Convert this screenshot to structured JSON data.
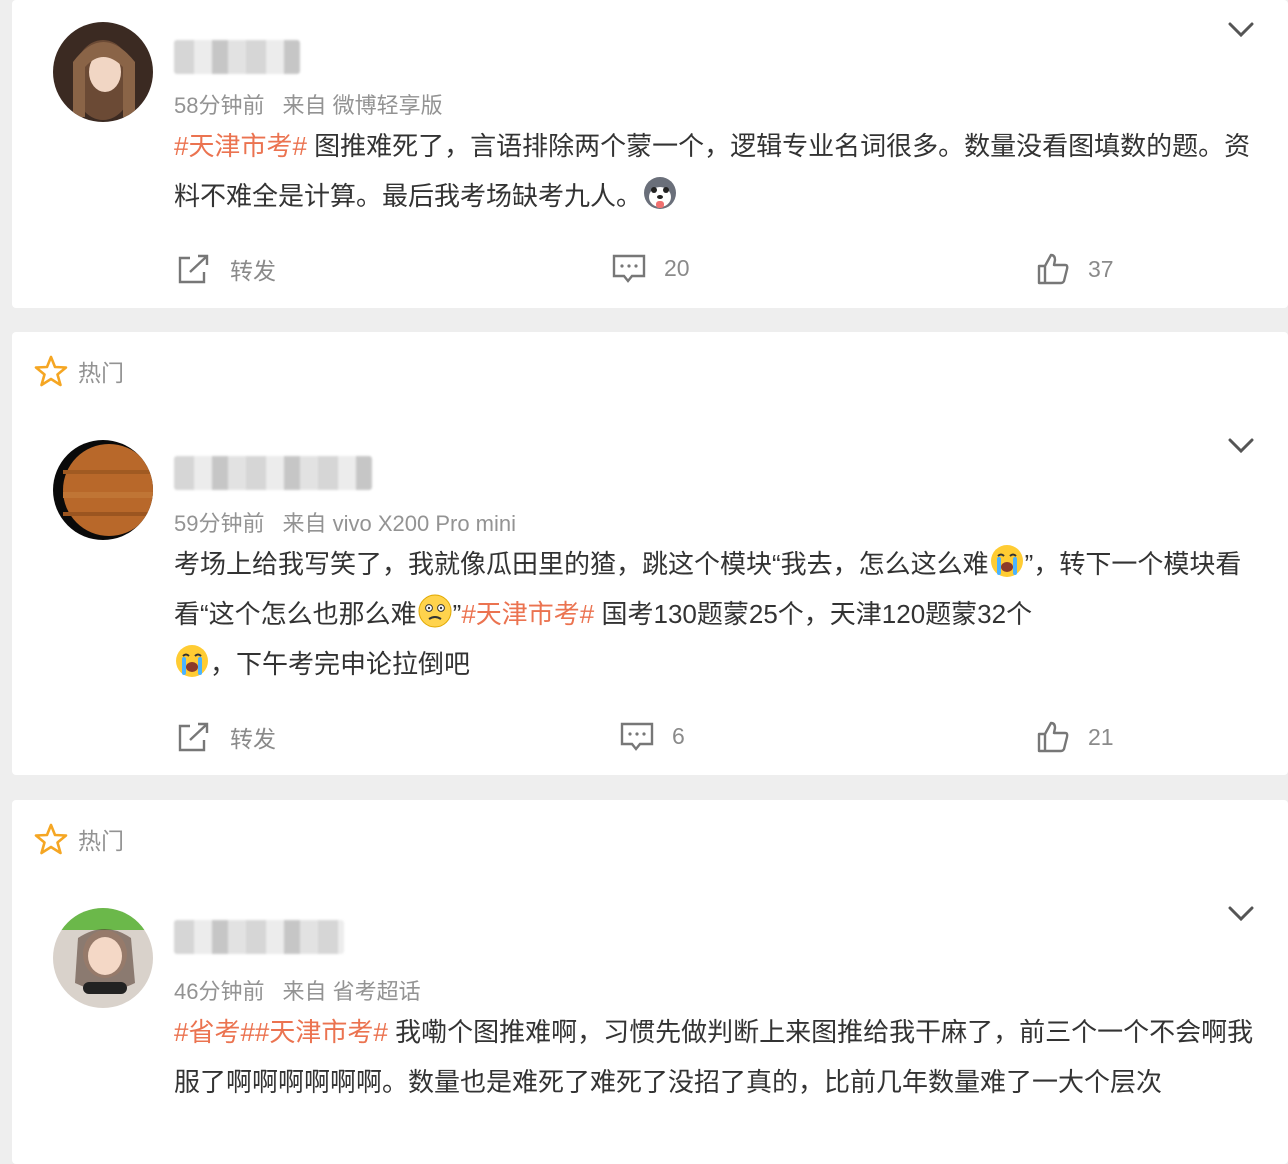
{
  "posts": [
    {
      "hot_label": "",
      "time": "58分钟前",
      "source": "来自 微博轻享版",
      "tags_prefix": "#天津市考#",
      "text_a": " 图推难死了，言语排除两个蒙一个，逻辑专业名词很多。数量没看图填数的题。资料不难全是计算。最后我考场缺考九人。",
      "repost_label": "转发",
      "comments": "20",
      "likes": "37"
    },
    {
      "hot_label": "热门",
      "time": "59分钟前",
      "source": "来自 vivo X200 Pro mini",
      "text_a": "考场上给我写笑了，我就像瓜田里的猹，跳这个模块“我去，怎么这么难",
      "text_b": "”，转下一个模块看看“这个怎么也那么难",
      "text_c": "”",
      "tag": "#天津市考#",
      "text_d": " 国考130题蒙25个，天津120题蒙32个",
      "text_e": "，下午考完申论拉倒吧",
      "repost_label": "转发",
      "comments": "6",
      "likes": "21"
    },
    {
      "hot_label": "热门",
      "time": "46分钟前",
      "source": "来自 省考超话",
      "tags_prefix": "#省考##天津市考#",
      "text_a": " 我嘞个图推难啊，习惯先做判断上来图推给我干麻了，前三个一个不会啊我服了啊啊啊啊啊啊。数量也是难死了难死了没招了真的，比前几年数量难了一大个层次"
    }
  ],
  "colors": {
    "accent": "#eb7350",
    "muted": "#939393",
    "text": "#333333"
  },
  "icons": [
    "chevron-down-icon",
    "repost-icon",
    "comment-icon",
    "like-icon",
    "hot-star-icon",
    "husky-emoji",
    "crying-emoji",
    "speechless-emoji"
  ]
}
